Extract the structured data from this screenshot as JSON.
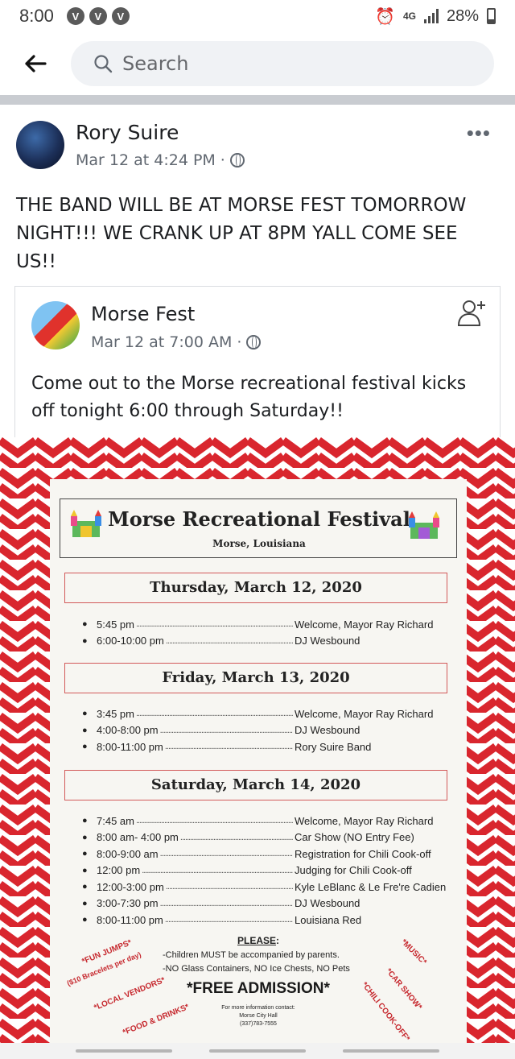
{
  "status_bar": {
    "time": "8:00",
    "notification_icons": [
      "V",
      "V",
      "V"
    ],
    "network": "4G",
    "battery": "28%"
  },
  "header": {
    "search_placeholder": "Search"
  },
  "post": {
    "author": "Rory Suire",
    "timestamp": "Mar 12 at 4:24 PM",
    "separator": "·",
    "text": "THE BAND WILL BE AT MORSE FEST TOMORROW NIGHT!!! WE CRANK UP AT 8PM YALL COME SEE US!!"
  },
  "shared_post": {
    "author": "Morse Fest",
    "timestamp": "Mar 12 at 7:00 AM",
    "separator": "·",
    "text": "Come out to the Morse recreational festival kicks off tonight 6:00 through Saturday!!"
  },
  "flyer": {
    "title": "Morse Recreational Festival",
    "location": "Morse, Louisiana",
    "days": [
      {
        "heading": "Thursday, March 12, 2020",
        "items": [
          {
            "time": "5:45 pm",
            "event": "Welcome, Mayor Ray Richard"
          },
          {
            "time": "6:00-10:00 pm",
            "event": "DJ Wesbound"
          }
        ]
      },
      {
        "heading": "Friday, March 13, 2020",
        "items": [
          {
            "time": "3:45 pm",
            "event": "Welcome, Mayor Ray Richard"
          },
          {
            "time": "4:00-8:00 pm",
            "event": "DJ Wesbound"
          },
          {
            "time": "8:00-11:00 pm",
            "event": "Rory Suire Band"
          }
        ]
      },
      {
        "heading": "Saturday, March 14, 2020",
        "items": [
          {
            "time": "7:45 am",
            "event": "Welcome, Mayor Ray Richard"
          },
          {
            "time": "8:00 am- 4:00 pm",
            "event": "Car Show (NO Entry Fee)"
          },
          {
            "time": "8:00-9:00 am",
            "event": "Registration for Chili Cook-off"
          },
          {
            "time": "12:00 pm",
            "event": "Judging for Chili Cook-off"
          },
          {
            "time": "12:00-3:00 pm",
            "event": "Kyle LeBlanc & Le Fre're Cadien"
          },
          {
            "time": "3:00-7:30 pm",
            "event": "DJ Wesbound"
          },
          {
            "time": "8:00-11:00 pm",
            "event": "Louisiana Red"
          }
        ]
      }
    ],
    "please": "PLEASE",
    "please_colon": ":",
    "rules": [
      "-Children MUST be accompanied by parents.",
      "-NO Glass Containers, NO Ice Chests, NO Pets"
    ],
    "free_admission": "*FREE ADMISSION*",
    "contact": [
      "For more information contact:",
      "Morse City Hall",
      "(337)783-7555"
    ],
    "left_tags": [
      "*FUN JUMPS*",
      "($10 Bracelets per day)",
      "*LOCAL VENDORS*",
      "*FOOD & DRINKS*"
    ],
    "right_tags": [
      "*MUSIC*",
      "*CAR SHOW*",
      "*CHILI COOK-OFF*"
    ]
  },
  "colors": {
    "chevron_red": "#d9262e",
    "facebook_grey": "#606770"
  }
}
